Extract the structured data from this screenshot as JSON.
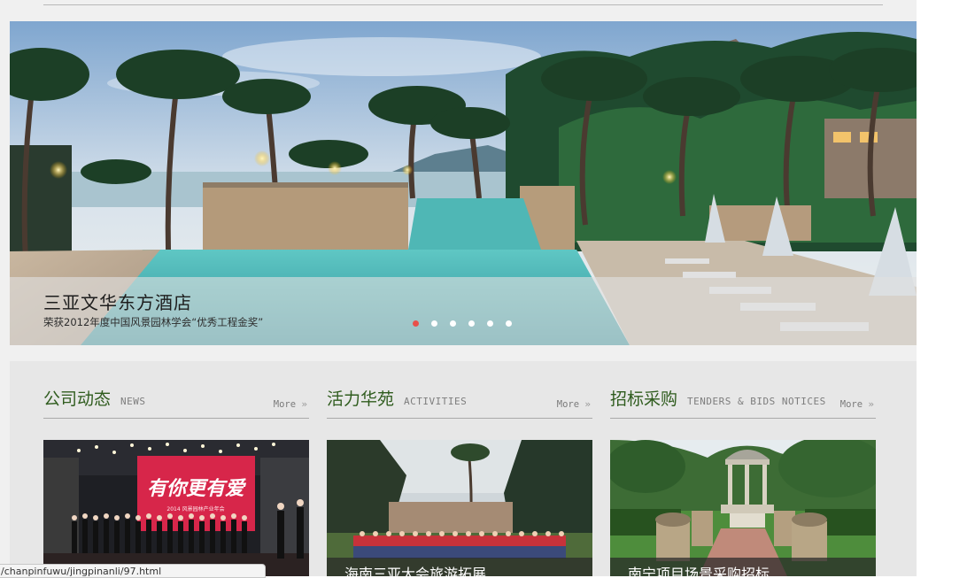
{
  "banner": {
    "title": "三亚文华东方酒店",
    "subtitle": "荣获2012年度中国风景园林学会“优秀工程金奖”",
    "slide_count": 6,
    "active_slide": 1
  },
  "columns": [
    {
      "title": "公司动态",
      "en_label": "NEWS",
      "more_label": "More",
      "image_caption": "",
      "stage_sign": "有你更有爱",
      "stage_sign_sub": "2014 风景园林产业年会"
    },
    {
      "title": "活力华苑",
      "en_label": "ACTIVITIES",
      "more_label": "More",
      "image_caption": "海南三亚大会旅游拓展"
    },
    {
      "title": "招标采购",
      "en_label": "TENDERS & BIDS NOTICES",
      "more_label": "More",
      "image_caption": "南宁项目场景采购招标"
    }
  ],
  "status_bar": {
    "url": "/chanpinfuwu/jingpinanli/97.html"
  },
  "colors": {
    "accent_dot": "#e8504a",
    "heading_green": "#2f5c1e"
  },
  "icons": {
    "more": "double-chevron-right-icon"
  }
}
